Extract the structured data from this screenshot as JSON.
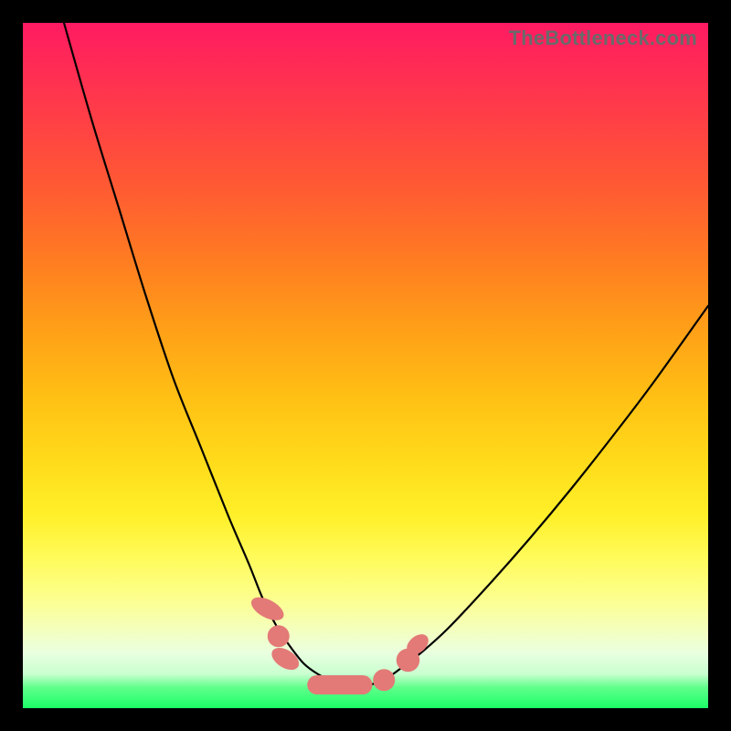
{
  "watermark": "TheBottleneck.com",
  "colors": {
    "frame_border": "#000000",
    "curve": "#000000",
    "marker": "#e37a77",
    "gradient_stops": [
      "#ff1a62",
      "#ff2a55",
      "#ff3f46",
      "#ff5a33",
      "#ff7a22",
      "#ff9d18",
      "#ffbe14",
      "#ffdb1a",
      "#fff02a",
      "#fffb5a",
      "#fcff8e",
      "#f3ffc2",
      "#e9ffe0",
      "#c9ffd0",
      "#5fff8a",
      "#1aff67"
    ]
  },
  "chart_data": {
    "type": "line",
    "title": "",
    "xlabel": "",
    "ylabel": "",
    "xlim": [
      0,
      100
    ],
    "ylim": [
      0,
      100
    ],
    "grid": false,
    "legend": false,
    "notes": "V-shaped bottleneck curve over vertical heat gradient. x and y are normalized 0-100 to the plot area. y=0 is the top edge (highest bottleneck), y≈100 is the bottom (lowest bottleneck). Left branch starts near top-left and descends steeply to a flat minimum around x≈42-50; right branch rises more slowly toward the right edge reaching roughly y≈35 at x=100.",
    "series": [
      {
        "name": "bottleneck-curve",
        "x": [
          6,
          10,
          14,
          18,
          22,
          26,
          30,
          33,
          35,
          37,
          39,
          41,
          43,
          45,
          47,
          49,
          51,
          53,
          55,
          58,
          62,
          68,
          74,
          80,
          86,
          92,
          100
        ],
        "y": [
          0,
          14,
          27,
          40,
          52,
          62,
          72,
          79,
          84,
          88,
          91,
          93.5,
          95,
          96,
          96.5,
          96.7,
          96.5,
          95.7,
          94.3,
          92,
          88.4,
          82,
          75.2,
          68,
          60.4,
          52.5,
          41.3
        ]
      }
    ],
    "markers": [
      {
        "shape": "ellipse",
        "cx": 35.7,
        "cy": 85.5,
        "rx": 1.3,
        "ry": 2.6,
        "rotation": -62
      },
      {
        "shape": "circle",
        "cx": 37.3,
        "cy": 89.5,
        "r": 1.6
      },
      {
        "shape": "ellipse",
        "cx": 38.3,
        "cy": 92.8,
        "rx": 1.3,
        "ry": 2.2,
        "rotation": -58
      },
      {
        "shape": "pill",
        "x1": 41.5,
        "x2": 51.0,
        "y": 96.6,
        "thickness": 2.8
      },
      {
        "shape": "circle",
        "cx": 52.7,
        "cy": 95.9,
        "r": 1.6
      },
      {
        "shape": "circle",
        "cx": 56.2,
        "cy": 93.0,
        "r": 1.7
      },
      {
        "shape": "ellipse",
        "cx": 57.6,
        "cy": 90.7,
        "rx": 1.2,
        "ry": 1.8,
        "rotation": 50
      }
    ]
  }
}
